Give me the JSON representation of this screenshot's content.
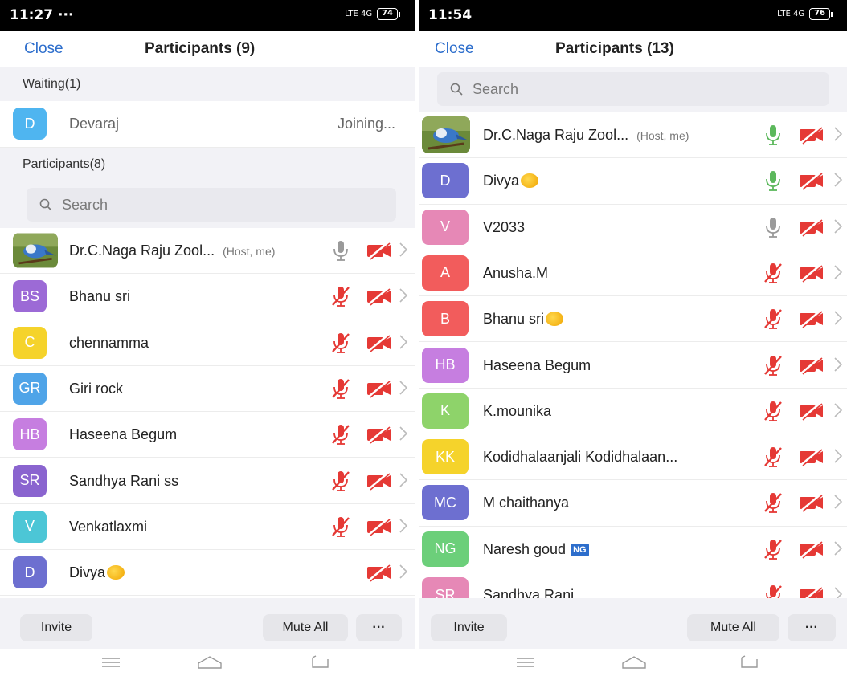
{
  "left": {
    "status": {
      "time": "11:27 ···",
      "network": "LTE 4G",
      "battery": "74"
    },
    "header": {
      "close": "Close",
      "title": "Participants (9)"
    },
    "waiting_label": "Waiting(1)",
    "waiting_user": {
      "initials": "D",
      "name": "Devaraj",
      "status": "Joining...",
      "color": "#4fb5f0"
    },
    "participants_label": "Participants(8)",
    "search_placeholder": "Search",
    "participants": [
      {
        "initials": "",
        "name": "Dr.C.Naga Raju Zool...",
        "tag": "(Host, me)",
        "color": "",
        "photo": true,
        "mic": "on-gray",
        "cam": "off"
      },
      {
        "initials": "BS",
        "name": "Bhanu sri",
        "tag": "",
        "color": "#9c6ad6",
        "mic": "off",
        "cam": "off"
      },
      {
        "initials": "C",
        "name": "chennamma",
        "tag": "",
        "color": "#f5d32b",
        "mic": "off",
        "cam": "off"
      },
      {
        "initials": "GR",
        "name": "Giri rock",
        "tag": "",
        "color": "#4fa4e8",
        "mic": "off",
        "cam": "off"
      },
      {
        "initials": "HB",
        "name": "Haseena Begum",
        "tag": "",
        "color": "#c67ee0",
        "mic": "off",
        "cam": "off"
      },
      {
        "initials": "SR",
        "name": "Sandhya Rani ss",
        "tag": "",
        "color": "#8a64cf",
        "mic": "off",
        "cam": "off"
      },
      {
        "initials": "V",
        "name": "Venkatlaxmi",
        "tag": "",
        "color": "#4cc6d6",
        "mic": "off",
        "cam": "off"
      },
      {
        "initials": "D",
        "name": "Divya",
        "tag": "",
        "color": "#6d6fd0",
        "mic": "none",
        "cam": "off",
        "emoji": true
      }
    ],
    "footer": {
      "invite": "Invite",
      "mute_all": "Mute All",
      "more": "···"
    }
  },
  "right": {
    "status": {
      "time": "11:54",
      "network": "LTE 4G",
      "battery": "76"
    },
    "header": {
      "close": "Close",
      "title": "Participants (13)"
    },
    "search_placeholder": "Search",
    "participants": [
      {
        "initials": "",
        "name": "Dr.C.Naga Raju Zool...",
        "tag": "(Host, me)",
        "color": "",
        "photo": true,
        "mic": "on-green",
        "cam": "off"
      },
      {
        "initials": "D",
        "name": "Divya",
        "tag": "",
        "color": "#6d6fd0",
        "mic": "on-green",
        "cam": "off",
        "emoji": true
      },
      {
        "initials": "V",
        "name": "V2033",
        "tag": "",
        "color": "#e688b6",
        "mic": "on-gray",
        "cam": "off"
      },
      {
        "initials": "A",
        "name": "Anusha.M",
        "tag": "",
        "color": "#f25c5c",
        "mic": "off",
        "cam": "off"
      },
      {
        "initials": "B",
        "name": "Bhanu sri",
        "tag": "",
        "color": "#f25c5c",
        "mic": "off",
        "cam": "off",
        "emoji": true
      },
      {
        "initials": "HB",
        "name": "Haseena Begum",
        "tag": "",
        "color": "#c67ee0",
        "mic": "off",
        "cam": "off"
      },
      {
        "initials": "K",
        "name": "K.mounika",
        "tag": "",
        "color": "#8ed36a",
        "mic": "off",
        "cam": "off"
      },
      {
        "initials": "KK",
        "name": "Kodidhalaanjali Kodidhalaan...",
        "tag": "",
        "color": "#f5d32b",
        "mic": "off",
        "cam": "off"
      },
      {
        "initials": "MC",
        "name": "M chaithanya",
        "tag": "",
        "color": "#6d6fd0",
        "mic": "off",
        "cam": "off"
      },
      {
        "initials": "NG",
        "name": "Naresh goud",
        "tag": "",
        "color": "#6ccf7a",
        "mic": "off",
        "cam": "off",
        "badge": "NG"
      },
      {
        "initials": "SR",
        "name": "Sandhya Rani",
        "tag": "",
        "color": "#e688b6",
        "mic": "off",
        "cam": "off"
      }
    ],
    "footer": {
      "invite": "Invite",
      "mute_all": "Mute All",
      "more": "···"
    }
  },
  "colors": {
    "accent": "#2d6ecc",
    "muted_red": "#e53935",
    "mic_green": "#5cb85c"
  }
}
